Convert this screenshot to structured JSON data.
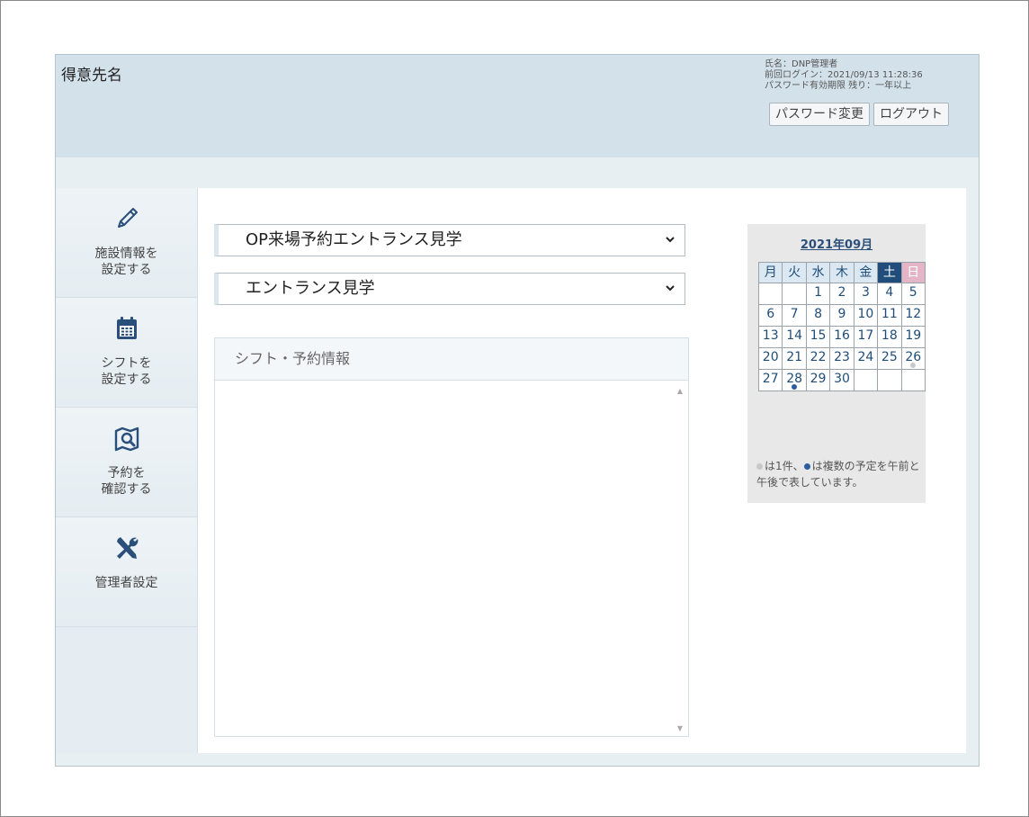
{
  "header": {
    "client_name": "得意先名",
    "user_name": "氏名：DNP管理者",
    "last_login": "前回ログイン：2021/09/13 11:28:36",
    "password_expiry": "パスワード有効期限 残り：一年以上",
    "change_password_label": "パスワード変更",
    "logout_label": "ログアウト",
    "background": "#d3e1ea"
  },
  "sidebar": {
    "items": [
      {
        "label": "施設情報を\n設定する",
        "icon": "pencil-icon"
      },
      {
        "label": "シフトを\n設定する",
        "icon": "calendar-icon"
      },
      {
        "label": "予約を\n確認する",
        "icon": "map-search-icon"
      },
      {
        "label": "管理者設定",
        "icon": "tools-icon"
      }
    ]
  },
  "main": {
    "facility_select": {
      "value": "OP来場予約エントランス見学"
    },
    "tour_select": {
      "value": "エントランス見学"
    },
    "panel_title": "シフト・予約情報"
  },
  "calendar": {
    "title": "2021年09月",
    "weekdays": [
      "月",
      "火",
      "水",
      "木",
      "金",
      "土",
      "日"
    ],
    "weeks": [
      [
        "",
        "",
        "1",
        "2",
        "3",
        "4",
        "5"
      ],
      [
        "6",
        "7",
        "8",
        "9",
        "10",
        "11",
        "12"
      ],
      [
        "13",
        "14",
        "15",
        "16",
        "17",
        "18",
        "19"
      ],
      [
        "20",
        "21",
        "22",
        "23",
        "24",
        "25",
        "26"
      ],
      [
        "27",
        "28",
        "29",
        "30",
        "",
        "",
        ""
      ]
    ],
    "single_dot_dates": [
      "26"
    ],
    "multi_dot_dates": [
      "28"
    ],
    "legend_single": "は1件、",
    "legend_multi": "は複数の予定を午前と午後で表しています。",
    "saturday_color": "#214d7a",
    "sunday_color": "#e3b5c6"
  }
}
